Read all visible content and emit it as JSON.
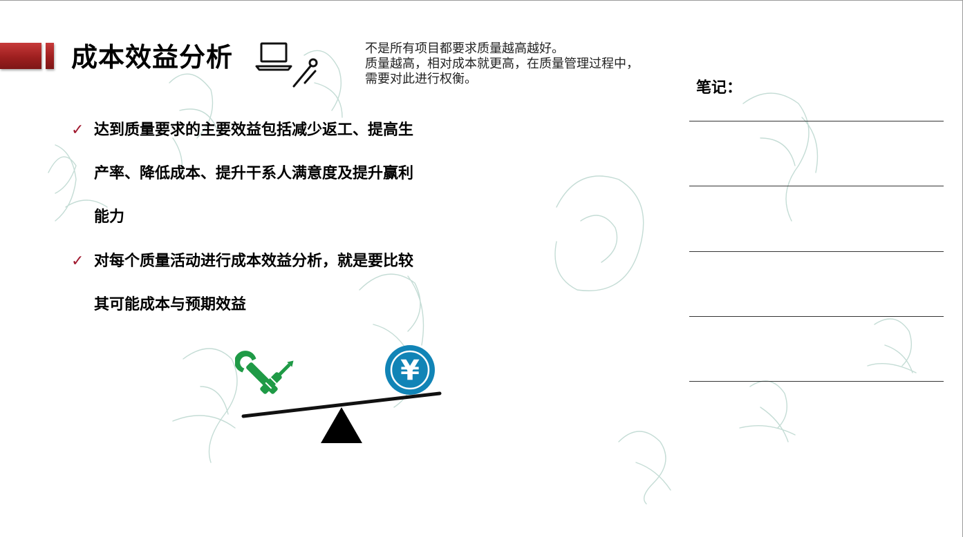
{
  "header": {
    "title": "成本效益分析"
  },
  "note": {
    "lines": [
      "不是所有项目都要求质量越高越好。",
      "质量越高，相对成本就更高，在质量管理过程中，",
      "需要对此进行权衡。"
    ]
  },
  "notes_panel": {
    "label": "笔记："
  },
  "bullets": [
    {
      "lines": [
        "达到质量要求的主要效益包括减少返工、提高生",
        "产率、降低成本、提升干系人满意度及提升赢利",
        "能力"
      ]
    },
    {
      "lines": [
        "对每个质量活动进行成本效益分析，就是要比较",
        "其可能成本与预期效益"
      ]
    }
  ],
  "illustration": {
    "currency_symbol": "¥"
  },
  "colors": {
    "accent_red": "#a0182e",
    "tools_green": "#1f9a46",
    "coin_blue": "#1184b6",
    "watermark": "#bfd9d2"
  }
}
